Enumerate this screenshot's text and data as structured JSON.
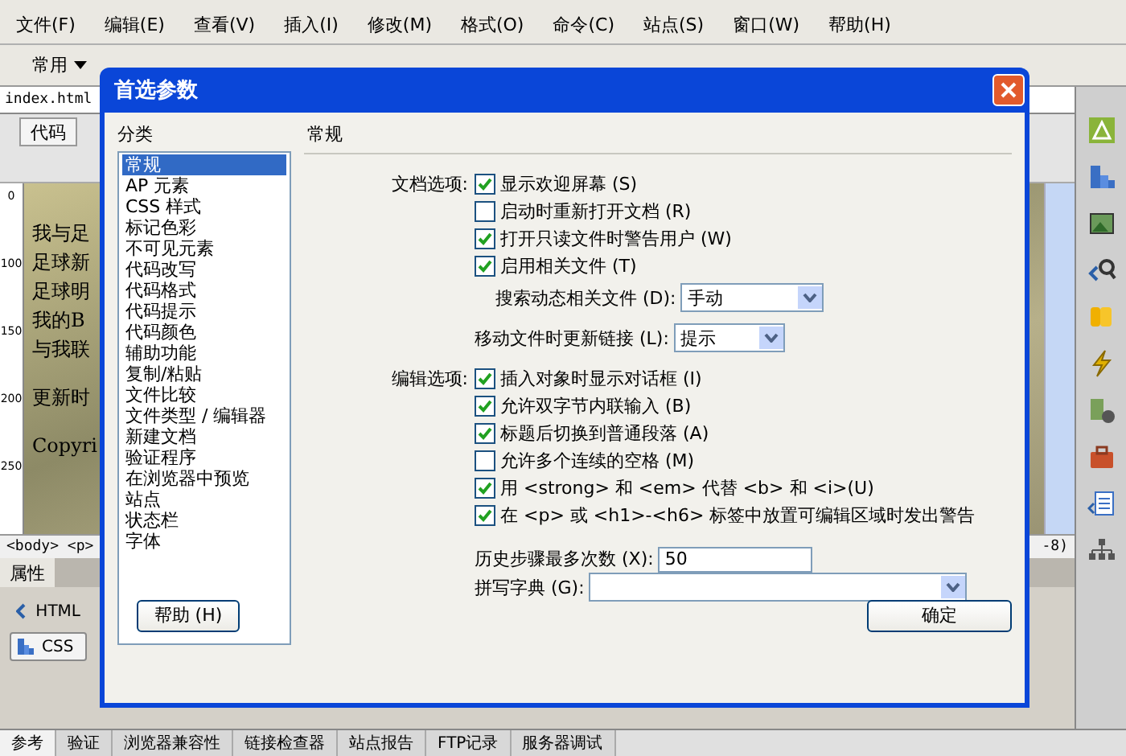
{
  "menu_bar": [
    "文件(F)",
    "编辑(E)",
    "查看(V)",
    "插入(I)",
    "修改(M)",
    "格式(O)",
    "命令(C)",
    "站点(S)",
    "窗口(W)",
    "帮助(H)"
  ],
  "toolbar": {
    "category": "常用"
  },
  "document": {
    "tab": "index.html",
    "view_button": "代码",
    "ruler_labels": [
      "0",
      "100",
      "150",
      "200",
      "250"
    ],
    "text_lines": [
      "我与足",
      "足球新",
      "足球明",
      "我的B",
      "与我联",
      "更新时",
      "Copyri"
    ],
    "tag_path": "<body> <p>",
    "status_fragment": "-8)"
  },
  "properties": {
    "title": "属性",
    "buttons": [
      {
        "label": "HTML",
        "selected": false
      },
      {
        "label": "CSS",
        "selected": true
      }
    ]
  },
  "bottom_tabs": [
    {
      "label": "参考",
      "selected": true
    },
    {
      "label": "验证",
      "selected": false
    },
    {
      "label": "浏览器兼容性",
      "selected": false
    },
    {
      "label": "链接检查器",
      "selected": false
    },
    {
      "label": "站点报告",
      "selected": false
    },
    {
      "label": "FTP记录",
      "selected": false
    },
    {
      "label": "服务器调试",
      "selected": false
    }
  ],
  "dialog": {
    "title": "首选参数",
    "category_heading": "分类",
    "categories": [
      {
        "label": "常规",
        "selected": true
      },
      {
        "label": "AP 元素",
        "selected": false
      },
      {
        "label": "CSS 样式",
        "selected": false
      },
      {
        "label": "标记色彩",
        "selected": false
      },
      {
        "label": "不可见元素",
        "selected": false
      },
      {
        "label": "代码改写",
        "selected": false
      },
      {
        "label": "代码格式",
        "selected": false
      },
      {
        "label": "代码提示",
        "selected": false
      },
      {
        "label": "代码颜色",
        "selected": false
      },
      {
        "label": "辅助功能",
        "selected": false
      },
      {
        "label": "复制/粘贴",
        "selected": false
      },
      {
        "label": "文件比较",
        "selected": false
      },
      {
        "label": "文件类型 / 编辑器",
        "selected": false
      },
      {
        "label": "新建文档",
        "selected": false
      },
      {
        "label": "验证程序",
        "selected": false
      },
      {
        "label": "在浏览器中预览",
        "selected": false
      },
      {
        "label": "站点",
        "selected": false
      },
      {
        "label": "状态栏",
        "selected": false
      },
      {
        "label": "字体",
        "selected": false
      }
    ],
    "section_title": "常规",
    "groups": [
      {
        "label": "文档选项:",
        "rows": [
          {
            "kind": "checkbox",
            "label": "显示欢迎屏幕 (S)",
            "checked": true
          },
          {
            "kind": "checkbox",
            "label": "启动时重新打开文档 (R)",
            "checked": false
          },
          {
            "kind": "checkbox",
            "label": "打开只读文件时警告用户 (W)",
            "checked": true
          },
          {
            "kind": "checkbox",
            "label": "启用相关文件 (T)",
            "checked": true
          },
          {
            "kind": "subselect",
            "label": "搜索动态相关文件 (D):",
            "value": "手动"
          },
          {
            "kind": "select",
            "label": "移动文件时更新链接 (L):",
            "value": "提示"
          }
        ]
      },
      {
        "label": "编辑选项:",
        "rows": [
          {
            "kind": "checkbox",
            "label": "插入对象时显示对话框 (I)",
            "checked": true
          },
          {
            "kind": "checkbox",
            "label": "允许双字节内联输入 (B)",
            "checked": true
          },
          {
            "kind": "checkbox",
            "label": "标题后切换到普通段落 (A)",
            "checked": true
          },
          {
            "kind": "checkbox",
            "label": "允许多个连续的空格 (M)",
            "checked": false
          },
          {
            "kind": "checkbox",
            "label": "用 <strong> 和 <em> 代替 <b> 和 <i>(U)",
            "checked": true
          },
          {
            "kind": "checkbox",
            "label": "在 <p> 或 <h1>-<h6> 标签中放置可编辑区域时发出警告",
            "checked": true
          },
          {
            "kind": "input",
            "label": "历史步骤最多次数 (X):",
            "value": "50"
          },
          {
            "kind": "wideselect",
            "label": "拼写字典 (G):"
          }
        ]
      }
    ],
    "buttons": [
      "帮助 (H)",
      "确定"
    ]
  }
}
